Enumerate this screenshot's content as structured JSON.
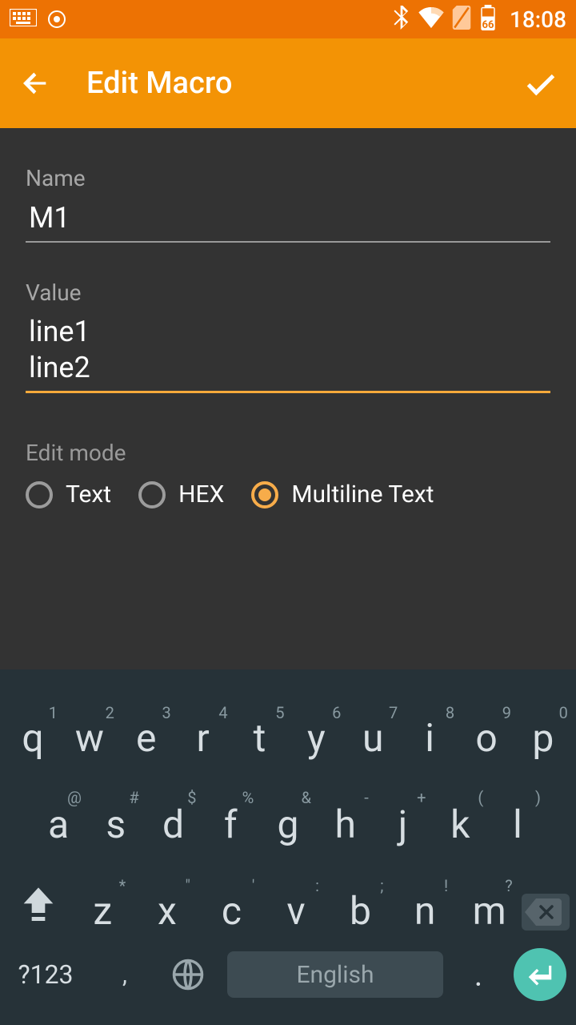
{
  "status": {
    "time": "18:08",
    "battery": "66"
  },
  "appbar": {
    "title": "Edit Macro"
  },
  "form": {
    "name_label": "Name",
    "name_value": "M1",
    "value_label": "Value",
    "value_text": "line1\nline2",
    "editmode_label": "Edit mode",
    "modes": [
      {
        "label": "Text",
        "selected": false
      },
      {
        "label": "HEX",
        "selected": false
      },
      {
        "label": "Multiline Text",
        "selected": true
      }
    ]
  },
  "keyboard": {
    "row1": [
      {
        "main": "q",
        "sup": "1"
      },
      {
        "main": "w",
        "sup": "2"
      },
      {
        "main": "e",
        "sup": "3"
      },
      {
        "main": "r",
        "sup": "4"
      },
      {
        "main": "t",
        "sup": "5"
      },
      {
        "main": "y",
        "sup": "6"
      },
      {
        "main": "u",
        "sup": "7"
      },
      {
        "main": "i",
        "sup": "8"
      },
      {
        "main": "o",
        "sup": "9"
      },
      {
        "main": "p",
        "sup": "0"
      }
    ],
    "row2": [
      {
        "main": "a",
        "sup": "@"
      },
      {
        "main": "s",
        "sup": "#"
      },
      {
        "main": "d",
        "sup": "$"
      },
      {
        "main": "f",
        "sup": "%"
      },
      {
        "main": "g",
        "sup": "&"
      },
      {
        "main": "h",
        "sup": "-"
      },
      {
        "main": "j",
        "sup": "+"
      },
      {
        "main": "k",
        "sup": "("
      },
      {
        "main": "l",
        "sup": ")"
      }
    ],
    "row3": [
      {
        "main": "z",
        "sup": "*"
      },
      {
        "main": "x",
        "sup": "\""
      },
      {
        "main": "c",
        "sup": "'"
      },
      {
        "main": "v",
        "sup": ":"
      },
      {
        "main": "b",
        "sup": ";"
      },
      {
        "main": "n",
        "sup": "!"
      },
      {
        "main": "m",
        "sup": "?"
      }
    ],
    "symkey": "?123",
    "comma": ",",
    "space_label": "English",
    "period": "."
  }
}
